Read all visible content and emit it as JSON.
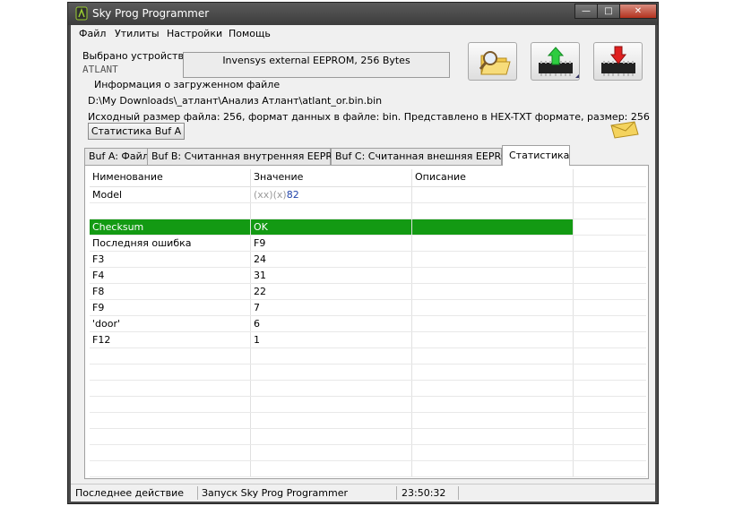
{
  "window": {
    "title": "Sky Prog Programmer"
  },
  "menu": [
    "Файл",
    "Утилиты",
    "Настройки",
    "Помощь"
  ],
  "device": {
    "label": "Выбрано устройство:",
    "name": "ATLANT",
    "info": "Invensys external EEPROM, 256 Bytes"
  },
  "file_info": {
    "group_title": "Информация о загруженном файле",
    "path": "D:\\My Downloads\\_атлант\\Анализ Атлант\\atlant_or.bin.bin",
    "details": "Исходный размер файла: 256, формат данных в файле: bin. Представлено в HEX-TXT формате, размер: 256",
    "stats_button": "Статистика Buf A"
  },
  "tabs": [
    "Buf A: Файл",
    "Buf B: Считанная внутренняя EEPROM",
    "Buf C: Считанная внешняя EEPROM",
    "Статистика"
  ],
  "grid": {
    "headers": [
      "Нименование",
      "Значение",
      "Описание"
    ],
    "model": {
      "name": "Model",
      "prefix": "(xx)(x)",
      "value": "82"
    },
    "rows": [
      {
        "name": "Checksum",
        "value": "OK",
        "desc": ""
      },
      {
        "name": "Последняя ошибка",
        "value": "F9",
        "desc": ""
      },
      {
        "name": "F3",
        "value": "24",
        "desc": ""
      },
      {
        "name": "F4",
        "value": "31",
        "desc": ""
      },
      {
        "name": "F8",
        "value": "22",
        "desc": ""
      },
      {
        "name": "F9",
        "value": "7",
        "desc": ""
      },
      {
        "name": "'door'",
        "value": "6",
        "desc": ""
      },
      {
        "name": "F12",
        "value": "1",
        "desc": ""
      }
    ]
  },
  "status": {
    "label": "Последнее действие",
    "action": "Запуск Sky Prog Programmer",
    "time": "23:50:32"
  },
  "colors": {
    "highlight": "#139a13",
    "chip_up_arrow": "#2ecc40",
    "chip_down_arrow": "#e02020"
  },
  "icons": [
    "app-icon",
    "open-file-icon",
    "write-chip-icon",
    "read-chip-icon",
    "envelope-icon"
  ]
}
